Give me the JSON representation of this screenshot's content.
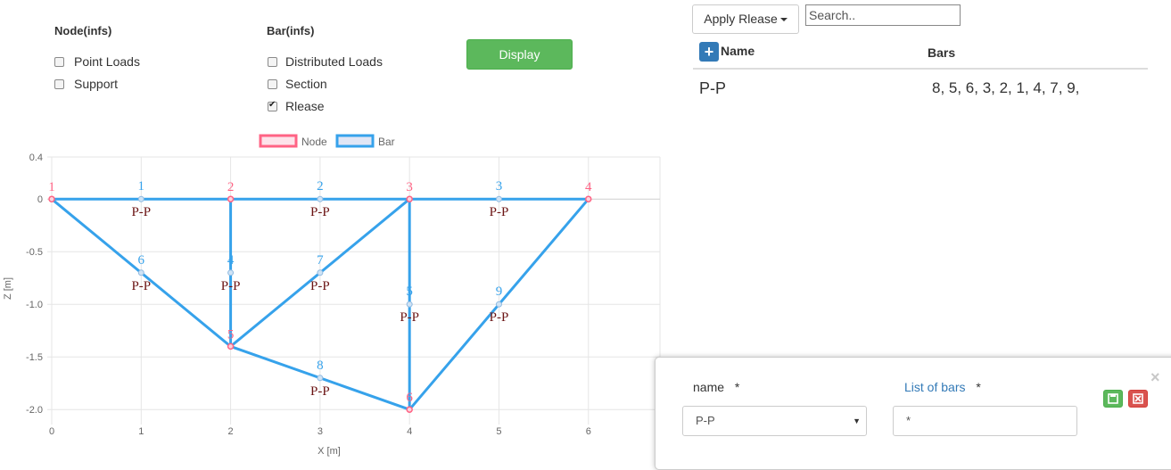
{
  "filters": {
    "node_heading": "Node(infs)",
    "bar_heading": "Bar(infs)",
    "node_options": [
      {
        "label": "Point Loads",
        "checked": false
      },
      {
        "label": "Support",
        "checked": false
      }
    ],
    "bar_options": [
      {
        "label": "Distributed Loads",
        "checked": false
      },
      {
        "label": "Section",
        "checked": false
      },
      {
        "label": "Rlease",
        "checked": true
      }
    ],
    "display_label": "Display"
  },
  "toolbar": {
    "apply_label": "Apply Rlease",
    "search_placeholder": "Search.."
  },
  "release_table": {
    "headers": [
      "Name",
      "Bars"
    ],
    "rows": [
      {
        "name": "P-P",
        "bars": "8, 5, 6, 3, 2, 1, 4, 7, 9,"
      }
    ]
  },
  "form": {
    "name_label": "name",
    "list_label": "List of bars",
    "required_mark": "*",
    "name_value": "P-P",
    "list_value": "*",
    "close_glyph": "×"
  },
  "chart_data": {
    "type": "scatter",
    "xlabel": "X [m]",
    "ylabel": "Z [m]",
    "xlim": [
      0,
      6.8
    ],
    "ylim": [
      -2.1,
      0.4
    ],
    "xticks": [
      0,
      1,
      2,
      3,
      4,
      5,
      6
    ],
    "yticks": [
      {
        "value": 0.4,
        "label": "0.4"
      },
      {
        "value": 0,
        "label": "0"
      },
      {
        "value": -0.5,
        "label": "-0.5"
      },
      {
        "value": -1.0,
        "label": "-1.0"
      },
      {
        "value": -1.5,
        "label": "-1.5"
      },
      {
        "value": -2.0,
        "label": "-2.0"
      }
    ],
    "legend": [
      {
        "name": "Node",
        "color": "#ff6384"
      },
      {
        "name": "Bar",
        "color": "#36a2eb"
      }
    ],
    "legend_position": "top",
    "grid": true,
    "nodes": [
      {
        "id": "1",
        "x": 0,
        "z": 0
      },
      {
        "id": "2",
        "x": 2,
        "z": 0
      },
      {
        "id": "3",
        "x": 4,
        "z": 0
      },
      {
        "id": "4",
        "x": 6,
        "z": 0
      },
      {
        "id": "5",
        "x": 2,
        "z": -1.4
      },
      {
        "id": "6",
        "x": 4,
        "z": -2.0
      }
    ],
    "bars": [
      {
        "id": "1",
        "from": "1",
        "to": "2",
        "release": "P-P"
      },
      {
        "id": "2",
        "from": "2",
        "to": "3",
        "release": "P-P"
      },
      {
        "id": "3",
        "from": "3",
        "to": "4",
        "release": "P-P"
      },
      {
        "id": "4",
        "from": "2",
        "to": "5",
        "release": "P-P"
      },
      {
        "id": "5",
        "from": "3",
        "to": "6",
        "release": "P-P"
      },
      {
        "id": "6",
        "from": "1",
        "to": "5",
        "release": "P-P"
      },
      {
        "id": "7",
        "from": "5",
        "to": "3",
        "release": "P-P"
      },
      {
        "id": "8",
        "from": "5",
        "to": "6",
        "release": "P-P"
      },
      {
        "id": "9",
        "from": "6",
        "to": "4",
        "release": "P-P"
      }
    ],
    "colors": {
      "node": "#ff6384",
      "bar": "#36a2eb",
      "release_label": "#6b1414",
      "grid": "#e5e5e5"
    }
  }
}
